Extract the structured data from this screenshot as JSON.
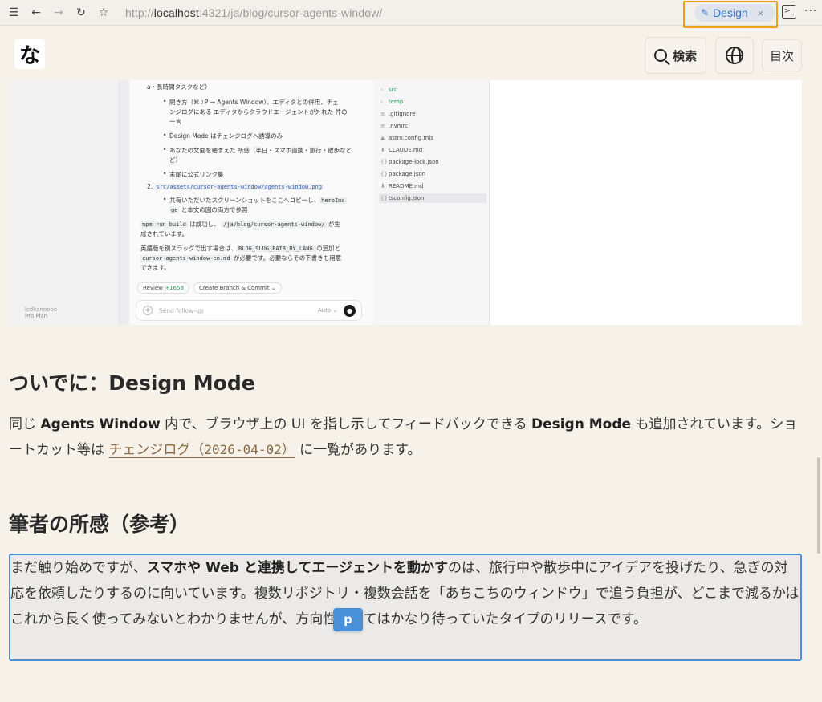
{
  "browser": {
    "url_prefix": "http://",
    "url_host": "localhost",
    "url_rest": ":4321/ja/blog/cursor-agents-window/",
    "design_tab_label": "Design",
    "design_tab_close": "×"
  },
  "header": {
    "logo_text": "な",
    "search_label": "検索",
    "toc_label": "目次"
  },
  "screenshot": {
    "chat_lines": [
      "a・長時間タスクなど）",
      "開き方（⌘⇧P → Agents Window）、エディタとの併用、チェ",
      "ンジログにある エディタからクラウドエージェントが外れた 件の",
      "一言",
      "Design Mode はチェンジログへ誘導のみ",
      "あなたの文面を踏まえた 所感（半日・スマホ連携・旅行・散歩など",
      "ど）",
      "末尾に公式リンク集",
      "共有いただいたスクリーンショットをここへコピーし、",
      "と本文の図の両方で参照",
      "は成功し、",
      "が生",
      "成されています。",
      "英語版を別スラッグで出す場合は、",
      "の追加と",
      "が必要です。必要ならその下書きも用意",
      "できます。"
    ],
    "list_number": "2.",
    "code_asset_path": "src/assets/cursor-agents-window/agents-window.png",
    "code_hero_a": "heroIma",
    "code_hero_b": "ge",
    "code_npm": "npm run build",
    "code_route": "/ja/blog/cursor-agents-window/",
    "code_slug_pair": "BLOG_SLUG_PAIR_BY_LANG",
    "code_en_file": "cursor-agents-window-en.md",
    "review_label": "Review",
    "review_count": "+1658",
    "branch_label": "Create Branch & Commit",
    "followup_placeholder": "Send follow-up",
    "auto_label": "Auto",
    "plan_label": "Pro Plan",
    "user_label": "lcdkanoooo",
    "files": [
      {
        "icon": "›",
        "name": "src"
      },
      {
        "icon": "›",
        "name": "temp"
      },
      {
        "icon": "≡",
        "name": ".gitignore"
      },
      {
        "icon": "≡",
        "name": ".nvmrc"
      },
      {
        "icon": "▲",
        "name": "astro.config.mjs"
      },
      {
        "icon": "⬇",
        "name": "CLAUDE.md"
      },
      {
        "icon": "{}",
        "name": "package-lock.json"
      },
      {
        "icon": "{}",
        "name": "package.json"
      },
      {
        "icon": "⬇",
        "name": "README.md"
      },
      {
        "icon": "{}",
        "name": "tsconfig.json"
      }
    ]
  },
  "article": {
    "section1_heading": "ついでに：Design Mode",
    "section1_p_a": "同じ ",
    "section1_p_b": "Agents Window",
    "section1_p_c": " 内で、ブラウザ上の UI を指し示してフィードバックできる ",
    "section1_p_d": "Design Mode",
    "section1_p_e": " も追加されています。ショートカット等は ",
    "section1_link_a": "チェンジログ（",
    "section1_link_date": "2026-04-02",
    "section1_link_b": "）",
    "section1_p_f": " に一覧があります。",
    "section2_heading": "筆者の所感（参考）",
    "section2_p_a": "まだ触り始めですが、",
    "section2_p_b": "スマホや Web と連携してエージェントを動かす",
    "section2_p_c": "のは、旅行中や散歩中にアイデアを投げたり、急ぎの対応を依頼したりするのに向いています。複数リポジトリ・複数会話を「あちこちのウィンドウ」で追う負担が、どこまで減るかはこれから長く使ってみないとわかりませんが、方向性としてはかなり待っていたタイプのリリースです。",
    "element_tag": "p"
  }
}
